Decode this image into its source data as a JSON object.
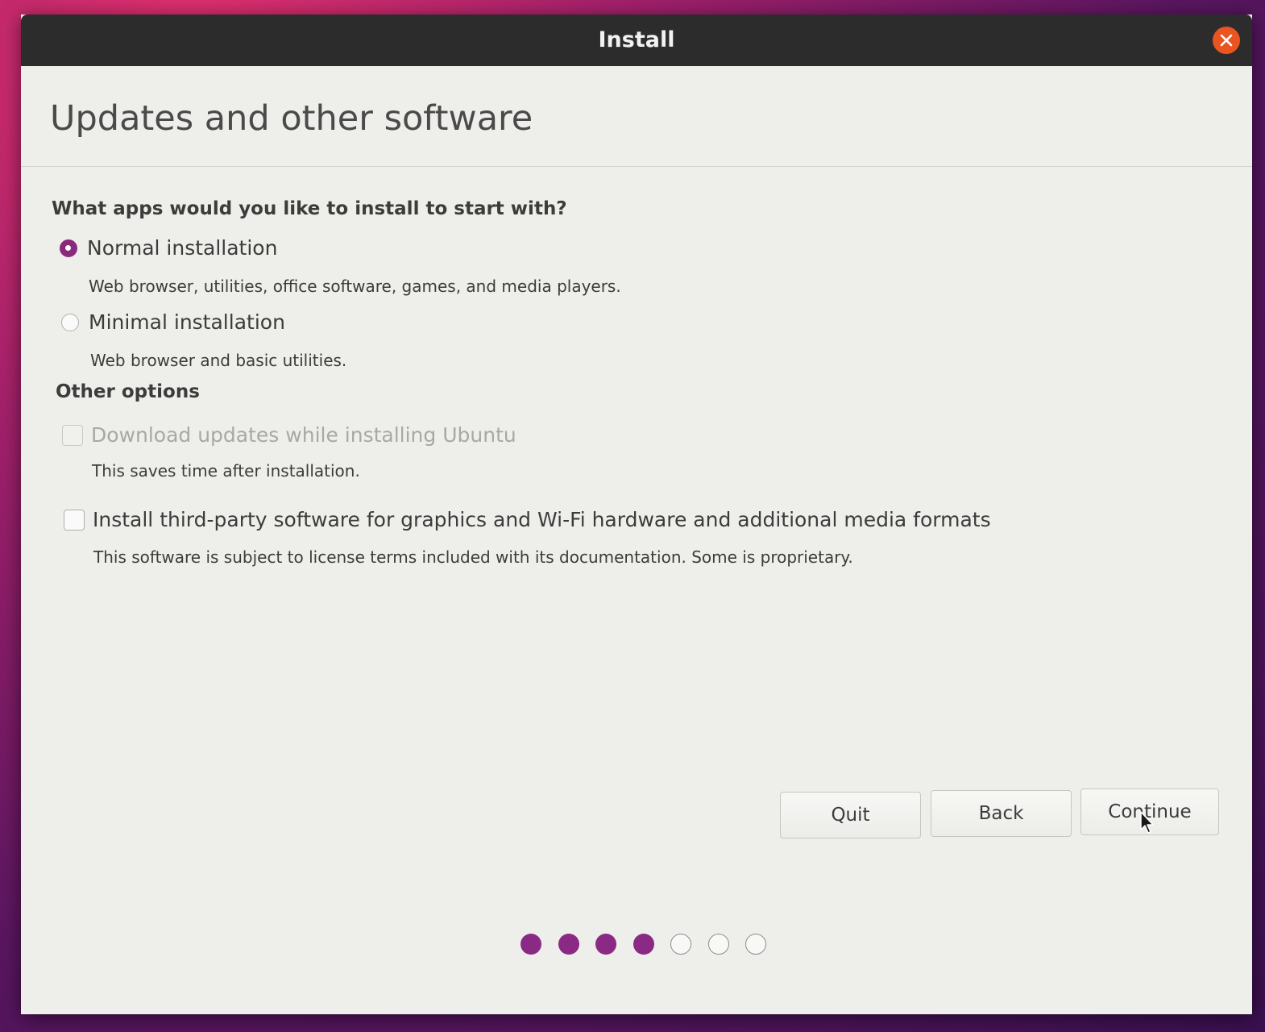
{
  "window": {
    "title": "Install",
    "close_icon": "close-icon"
  },
  "page": {
    "title": "Updates and other software"
  },
  "apps_section": {
    "heading": "What apps would you like to install to start with?",
    "options": [
      {
        "label": "Normal installation",
        "description": "Web browser, utilities, office software, games, and media players.",
        "selected": true
      },
      {
        "label": "Minimal installation",
        "description": "Web browser and basic utilities.",
        "selected": false
      }
    ]
  },
  "other_section": {
    "heading": "Other options",
    "options": [
      {
        "label": "Download updates while installing Ubuntu",
        "description": "This saves time after installation.",
        "checked": false,
        "enabled": false
      },
      {
        "label": "Install third-party software for graphics and Wi-Fi hardware and additional media formats",
        "description": "This software is subject to license terms included with its documentation. Some is proprietary.",
        "checked": false,
        "enabled": true
      }
    ]
  },
  "buttons": {
    "quit": "Quit",
    "back": "Back",
    "continue": "Continue"
  },
  "progress": {
    "total_steps": 7,
    "completed_steps": 4
  },
  "colors": {
    "accent": "#8a2a85",
    "close_button": "#e95420",
    "titlebar": "#2c2c2c",
    "window_background": "#eeeeea"
  }
}
